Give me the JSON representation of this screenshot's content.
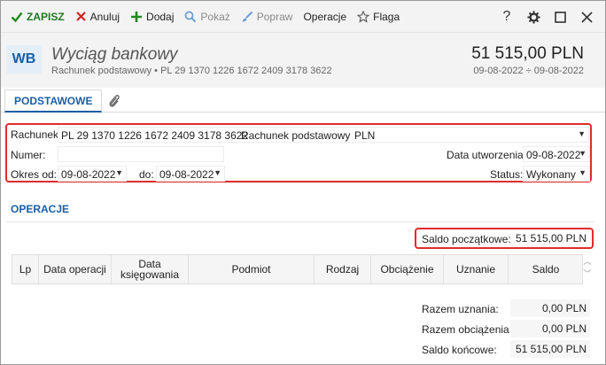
{
  "toolbar": {
    "save_label": "ZAPISZ",
    "cancel_label": "Anuluj",
    "add_label": "Dodaj",
    "show_label": "Pokaż",
    "edit_label": "Popraw",
    "operations_label": "Operacje",
    "flag_label": "Flaga"
  },
  "header": {
    "badge": "WB",
    "title": "Wyciąg bankowy",
    "subtitle": "Rachunek podstawowy  •  PL 29 1370 1226 1672 2409 3178 3622",
    "amount": "51 515,00 PLN",
    "dates": "09-08-2022 ÷ 09-08-2022"
  },
  "tabs": {
    "main": "PODSTAWOWE"
  },
  "form": {
    "account_label": "Rachunek:",
    "account_number": "PL 29 1370 1226 1672 2409 3178 3622",
    "account_name": "Rachunek podstawowy",
    "account_currency": "PLN",
    "number_label": "Numer:",
    "number_value": "",
    "created_label": "Data utworzenia:",
    "created_value": "09-08-2022",
    "period_label": "Okres od:",
    "period_from": "09-08-2022",
    "period_to_label": "do:",
    "period_to": "09-08-2022",
    "status_label": "Status:",
    "status_value": "Wykonany"
  },
  "operations": {
    "title": "OPERACJE",
    "opening_balance_label": "Saldo początkowe:",
    "opening_balance_value": "51 515,00 PLN",
    "columns": [
      "Lp",
      "Data operacji",
      "Data\nksięgowania",
      "Podmiot",
      "Rodzaj",
      "Obciążenie",
      "Uznanie",
      "Saldo"
    ]
  },
  "summary": {
    "credits_label": "Razem uznania:",
    "credits_value": "0,00 PLN",
    "debits_label": "Razem obciążenia:",
    "debits_value": "0,00 PLN",
    "closing_label": "Saldo końcowe:",
    "closing_value": "51 515,00 PLN"
  },
  "icons": {
    "save": "check-icon",
    "cancel": "x-icon",
    "add": "plus-icon",
    "show": "search-icon",
    "edit": "brush-icon",
    "flag": "star-icon",
    "help": "question-icon",
    "settings": "gear-icon",
    "maximize": "square-icon",
    "close": "close-icon",
    "attachment": "paperclip-icon"
  }
}
